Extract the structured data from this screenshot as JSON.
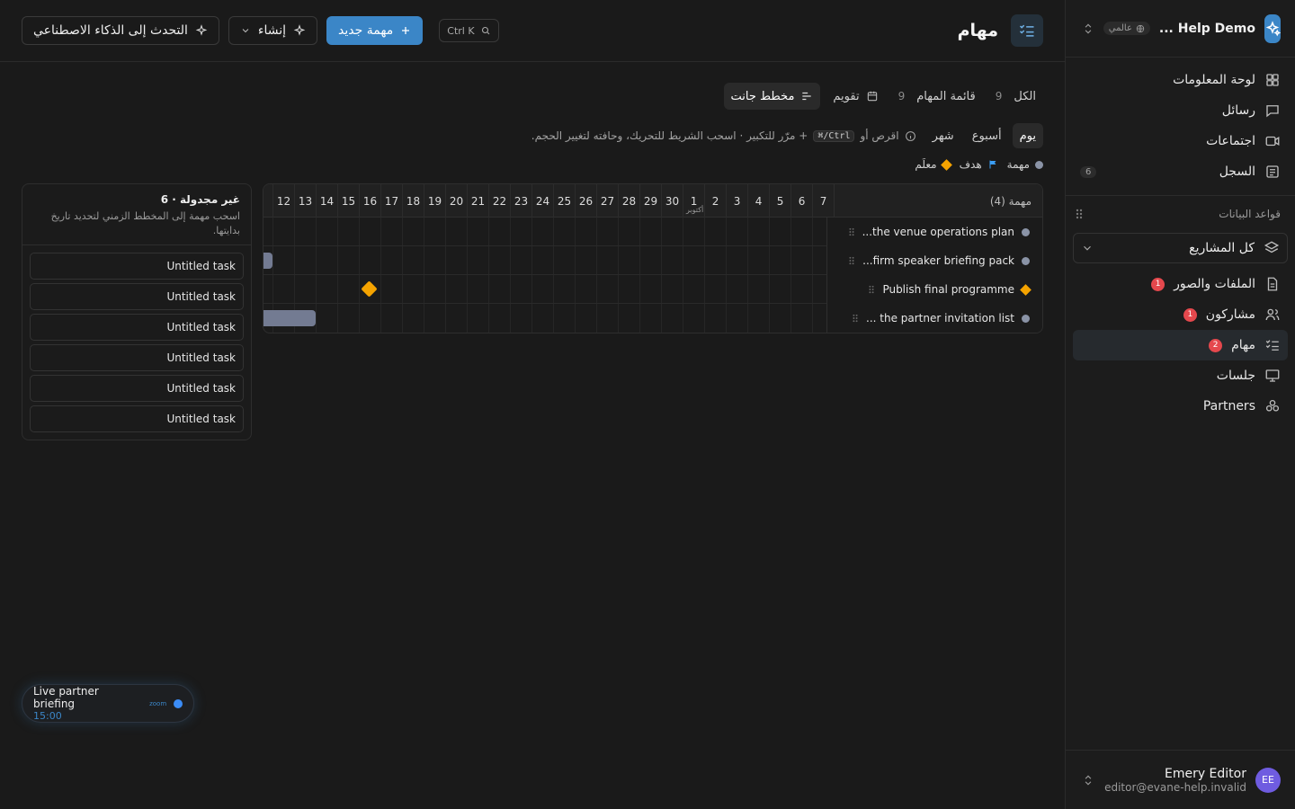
{
  "workspace": {
    "name": "Help Demo ...",
    "badge": "عالمي"
  },
  "sidebar": {
    "items": [
      {
        "label": "لوحة المعلومات",
        "icon": "dashboard-icon"
      },
      {
        "label": "رسائل",
        "icon": "message-icon"
      },
      {
        "label": "اجتماعات",
        "icon": "video-icon"
      },
      {
        "label": "السجل",
        "icon": "log-icon",
        "count": "6"
      }
    ],
    "databases_label": "قواعد البيانات",
    "project_selector": "كل المشاريع",
    "db_items": [
      {
        "label": "الملفات والصور",
        "icon": "file-icon",
        "alert": "1"
      },
      {
        "label": "مشاركون",
        "icon": "users-icon",
        "alert": "1"
      },
      {
        "label": "مهام",
        "icon": "tasks-icon",
        "alert": "2",
        "active": true
      },
      {
        "label": "جلسات",
        "icon": "presentation-icon"
      },
      {
        "label": "Partners",
        "icon": "partners-icon"
      }
    ]
  },
  "user": {
    "name": "Emery Editor",
    "email": "editor@evane-help.invalid",
    "initials": "EE"
  },
  "header": {
    "title": "مهام",
    "search_shortcut": "Ctrl K",
    "new_task": "مهمة جديد",
    "create": "إنشاء",
    "ai_chat": "التحدث إلى الذكاء الاصطناعي"
  },
  "views": {
    "all": {
      "label": "الكل",
      "count": "9"
    },
    "list": {
      "label": "قائمة المهام",
      "count": "9"
    },
    "calendar": {
      "label": "تقويم"
    },
    "gantt": {
      "label": "مخطط جانت"
    }
  },
  "zoom": {
    "day": "يوم",
    "week": "أسبوع",
    "month": "شهر"
  },
  "hint": {
    "pre": "اقرص أو",
    "key": "⌘/Ctrl",
    "post": "+ مرّر للتكبير · اسحب الشريط للتحريك، وحافته لتغيير الحجم."
  },
  "legend": {
    "task": "مهمة",
    "goal": "هدف",
    "milestone": "معلَم"
  },
  "gantt": {
    "label_header": "مهمة (4)",
    "days": [
      "12",
      "13",
      "14",
      "15",
      "16",
      "17",
      "18",
      "19",
      "20",
      "21",
      "22",
      "23",
      "24",
      "25",
      "26",
      "27",
      "28",
      "29",
      "30",
      "1",
      "2",
      "3",
      "4",
      "5",
      "6",
      "7"
    ],
    "month_label": "أكتوبر",
    "rows": [
      {
        "label": "...the venue operations plan",
        "kind": "task"
      },
      {
        "label": "...firm speaker briefing pack",
        "kind": "task"
      },
      {
        "label": "Publish final programme",
        "kind": "milestone"
      },
      {
        "label": "... the partner invitation list",
        "kind": "task"
      }
    ]
  },
  "unscheduled": {
    "title": "غير مجدولة · 6",
    "desc": "اسحب مهمة إلى المخطط الزمني لتحديد تاريخ بدايتها.",
    "items": [
      "Untitled task",
      "Untitled task",
      "Untitled task",
      "Untitled task",
      "Untitled task",
      "Untitled task"
    ]
  },
  "meeting": {
    "title": "Live partner briefing",
    "time": "15:00",
    "provider": "zoom"
  },
  "colors": {
    "accent": "#3b86c7",
    "milestone": "#f5a300",
    "alert": "#e5484d",
    "bar": "#737b92"
  }
}
